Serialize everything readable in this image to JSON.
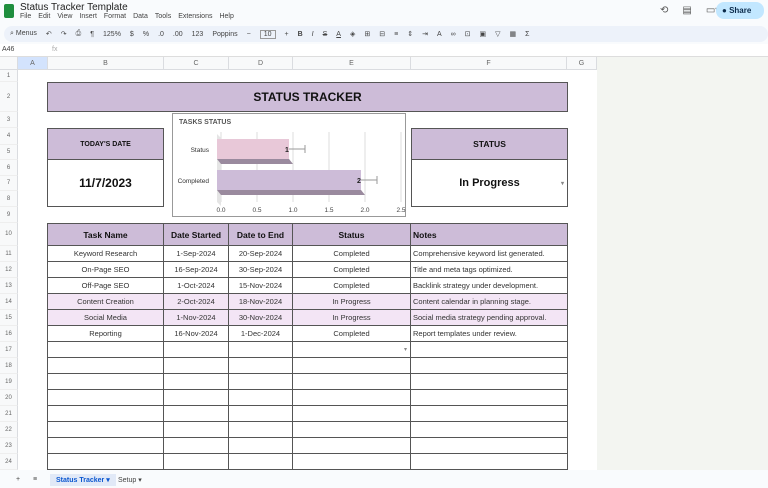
{
  "app": {
    "title": "Status Tracker Template",
    "menu": [
      "File",
      "Edit",
      "View",
      "Insert",
      "Format",
      "Data",
      "Tools",
      "Extensions",
      "Help"
    ],
    "share_label": "Share"
  },
  "toolbar": {
    "search": "Menus",
    "zoom": "125%",
    "currency": "$",
    "percent": "%",
    "format123": "123",
    "font": "Poppins",
    "font_size": "10"
  },
  "formula_bar": {
    "cell_ref": "A46",
    "fx": "fx"
  },
  "columns": [
    "A",
    "B",
    "C",
    "D",
    "E",
    "F",
    "G"
  ],
  "rows": [
    "1",
    "2",
    "3",
    "4",
    "5",
    "6",
    "7",
    "8",
    "9",
    "10",
    "11",
    "12",
    "13",
    "14",
    "15",
    "16",
    "17",
    "18",
    "19",
    "20",
    "21",
    "22",
    "23",
    "24"
  ],
  "tracker": {
    "title": "STATUS TRACKER",
    "today_label": "TODAY'S DATE",
    "today_value": "11/7/2023",
    "status_label": "STATUS",
    "status_value": "In Progress"
  },
  "table": {
    "headers": [
      "Task Name",
      "Date Started",
      "Date to End",
      "Status",
      "Notes"
    ],
    "rows": [
      [
        "Keyword Research",
        "1-Sep-2024",
        "20-Sep-2024",
        "Completed",
        "Comprehensive keyword list generated."
      ],
      [
        "On-Page SEO",
        "16-Sep-2024",
        "30-Sep-2024",
        "Completed",
        "Title and meta tags optimized."
      ],
      [
        "Off-Page SEO",
        "1-Oct-2024",
        "15-Nov-2024",
        "Completed",
        "Backlink strategy under development."
      ],
      [
        "Content Creation",
        "2-Oct-2024",
        "18-Nov-2024",
        "In Progress",
        "Content calendar in planning stage."
      ],
      [
        "Social Media",
        "1-Nov-2024",
        "30-Nov-2024",
        "In Progress",
        "Social media strategy pending approval."
      ],
      [
        "Reporting",
        "16-Nov-2024",
        "1-Dec-2024",
        "Completed",
        "Report templates under review."
      ]
    ]
  },
  "colors": {
    "header": "#cdbcd8",
    "in_progress_row": "#f3e5f5",
    "bar_status": "#e8c8d8",
    "bar_completed": "#cdbcd8"
  },
  "chart_data": {
    "type": "bar",
    "orientation": "horizontal",
    "title": "TASKS STATUS",
    "categories": [
      "Status",
      "Completed"
    ],
    "values": [
      1,
      2
    ],
    "data_labels": [
      "1",
      "2"
    ],
    "xlim": [
      0,
      2.5
    ],
    "x_ticks": [
      "0.0",
      "0.5",
      "1.0",
      "1.5",
      "2.0",
      "2.5"
    ],
    "grid": true,
    "error_bars": true
  },
  "sheet_tabs": [
    {
      "label": "Status Tracker",
      "active": true
    },
    {
      "label": "Setup",
      "active": false
    }
  ]
}
